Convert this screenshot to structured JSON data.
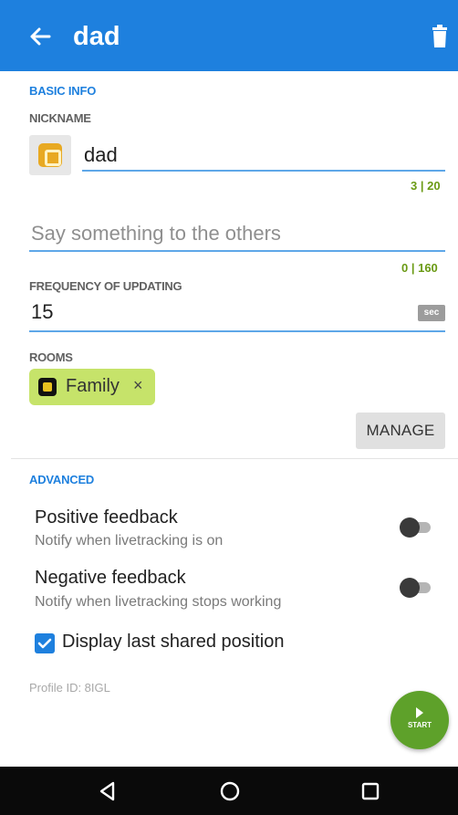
{
  "appbar": {
    "title": "dad"
  },
  "basic_info": {
    "section_label": "BASIC INFO",
    "nickname_label": "NICKNAME",
    "nickname_value": "dad",
    "nickname_counter": "3 | 20",
    "message_placeholder": "Say something to the others",
    "message_counter": "0 | 160",
    "frequency_label": "FREQUENCY OF UPDATING",
    "frequency_value": "15",
    "frequency_unit": "sec",
    "rooms_label": "ROOMS",
    "room_chip_label": "Family",
    "room_chip_close": "×",
    "manage_label": "MANAGE"
  },
  "advanced": {
    "section_label": "ADVANCED",
    "positive_title": "Positive feedback",
    "positive_sub": "Notify when livetracking is on",
    "positive_on": false,
    "negative_title": "Negative feedback",
    "negative_sub": "Notify when livetracking stops working",
    "negative_on": false,
    "display_last_label": "Display last shared position",
    "display_last_checked": true
  },
  "profile_id": "Profile ID: 8IGL",
  "fab": {
    "label": "START"
  },
  "colors": {
    "primary": "#1e80de",
    "accent_green": "#5ea12a",
    "chip": "#c6e36a",
    "counter": "#6a9a14"
  },
  "icons": {
    "back": "arrow-left-icon",
    "delete": "trash-icon",
    "nav_back": "triangle-back-icon",
    "nav_home": "circle-home-icon",
    "nav_recents": "square-recents-icon"
  }
}
